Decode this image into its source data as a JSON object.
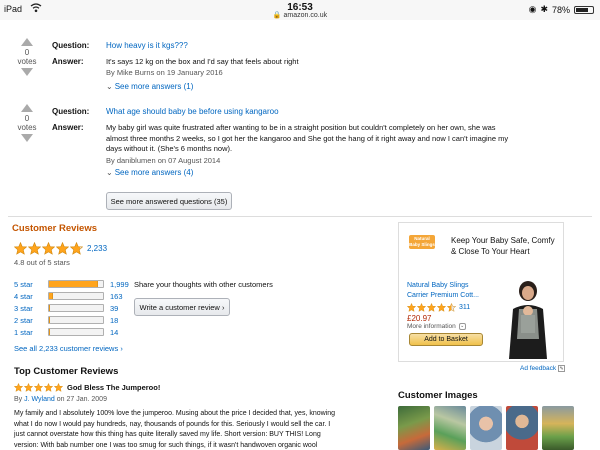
{
  "status_bar": {
    "carrier": "iPad",
    "time": "16:53",
    "url": "amazon.co.uk",
    "battery": "78%",
    "battery_level": 0.78
  },
  "qa": [
    {
      "votes": "0",
      "votes_label": "votes",
      "question_label": "Question:",
      "question": "How heavy is it kgs???",
      "answer_label": "Answer:",
      "answer": "It's says 12 kg on the box and I'd say that feels about right",
      "byline": "By Mike Burns on 19 January 2016",
      "more_answers": "See more answers (1)"
    },
    {
      "votes": "0",
      "votes_label": "votes",
      "question_label": "Question:",
      "question": "What age should baby be before using kangaroo",
      "answer_label": "Answer:",
      "answer_lines": [
        "My baby girl was quite frustrated after wanting to be in a straight position but couldn't completely on her own, she was",
        "almost three months 2 weeks, so I got her the kangaroo and She got the hang of it right away and now I can't imagine my",
        "days without it. (She's 6 months now)."
      ],
      "byline": "By daniblumen on 07 August 2014",
      "more_answers": "See more answers (4)"
    }
  ],
  "see_more_questions": "See more answered questions (35)",
  "reviews": {
    "heading": "Customer Reviews",
    "rating_count": "2,233",
    "rating_text": "4.8 out of 5 stars",
    "rating_value": 4.8,
    "histogram": [
      {
        "label": "5 star",
        "count": "1,999",
        "fraction": 0.9
      },
      {
        "label": "4 star",
        "count": "163",
        "fraction": 0.07
      },
      {
        "label": "3 star",
        "count": "39",
        "fraction": 0.02
      },
      {
        "label": "2 star",
        "count": "18",
        "fraction": 0.01
      },
      {
        "label": "1 star",
        "count": "14",
        "fraction": 0.01
      }
    ],
    "share_text": "Share your thoughts with other customers",
    "write_review": "Write a customer review",
    "see_all": "See all 2,233 customer reviews"
  },
  "ad": {
    "brand_logo": "Natural Baby Slings",
    "tagline_line1": "Keep Your Baby Safe, Comfy",
    "tagline_line2": "& Close To Your Heart",
    "product_line1": "Natural Baby Slings",
    "product_line2": "Carrier Premium Cott...",
    "rating_count": "311",
    "price": "£20.97",
    "more_info": "More information",
    "add_to_basket": "Add to Basket",
    "feedback": "Ad feedback",
    "colors": {
      "price": "#b12704",
      "logo_bg": "#f4a638"
    }
  },
  "top_reviews": {
    "heading": "Top Customer Reviews",
    "review": {
      "title": "God Bless The Jumperoo!",
      "byline_prefix": "By",
      "author": "J. Wyland",
      "date": "on 27 Jan. 2009",
      "lines": [
        "My family and I absolutely 100% love the jumperoo. Musing about the price I decided that, yes, knowing",
        "what I do now I would pay hundreds, nay, thousands of pounds for this. Seriously I would sell the car. I",
        "just cannot overstate how this thing has quite literally saved my life. Short version: BUY THIS! Long",
        "version: With bab number one I was too smug for such things, if it wasn't handwoven organic wool"
      ]
    }
  },
  "customer_images": {
    "heading": "Customer Images"
  },
  "colors": {
    "link": "#0066c0",
    "star": "#ffa41c",
    "heading_orange": "#c45500"
  }
}
